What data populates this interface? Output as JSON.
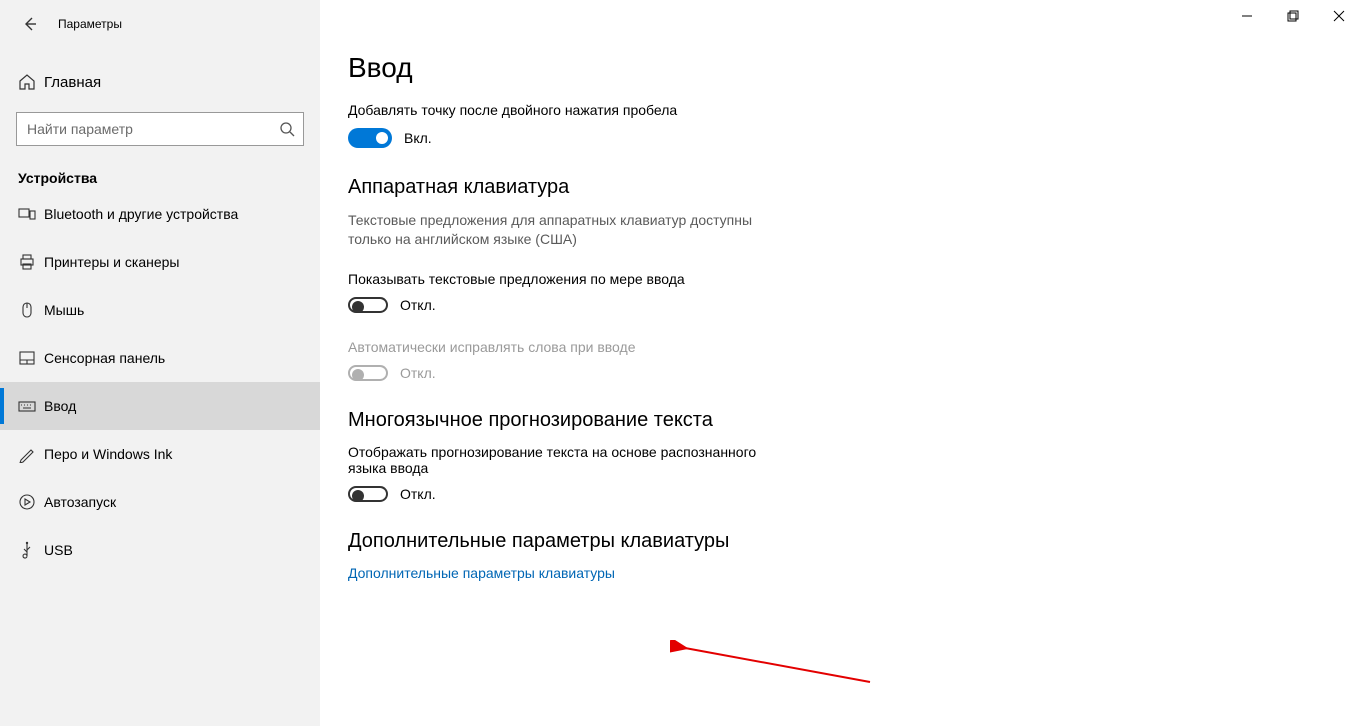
{
  "window": {
    "title": "Параметры"
  },
  "sidebar": {
    "home_label": "Главная",
    "search_placeholder": "Найти параметр",
    "category": "Устройства",
    "items": [
      {
        "label": "Bluetooth и другие устройства",
        "icon": "bluetooth"
      },
      {
        "label": "Принтеры и сканеры",
        "icon": "printer"
      },
      {
        "label": "Мышь",
        "icon": "mouse"
      },
      {
        "label": "Сенсорная панель",
        "icon": "touchpad"
      },
      {
        "label": "Ввод",
        "icon": "keyboard"
      },
      {
        "label": "Перо и Windows Ink",
        "icon": "pen"
      },
      {
        "label": "Автозапуск",
        "icon": "autoplay"
      },
      {
        "label": "USB",
        "icon": "usb"
      }
    ]
  },
  "main": {
    "page_title": "Ввод",
    "setting1_label": "Добавлять точку после двойного нажатия пробела",
    "on_label": "Вкл.",
    "off_label": "Откл.",
    "section2_title": "Аппаратная клавиатура",
    "section2_desc": "Текстовые предложения для аппаратных клавиатур доступны только на английском языке (США)",
    "setting2_label": "Показывать текстовые предложения по мере ввода",
    "setting3_label": "Автоматически исправлять слова при вводе",
    "section3_title": "Многоязычное прогнозирование текста",
    "setting4_label": "Отображать прогнозирование текста на основе распознанного языка ввода",
    "section4_title": "Дополнительные параметры клавиатуры",
    "link_label": "Дополнительные параметры клавиатуры"
  }
}
